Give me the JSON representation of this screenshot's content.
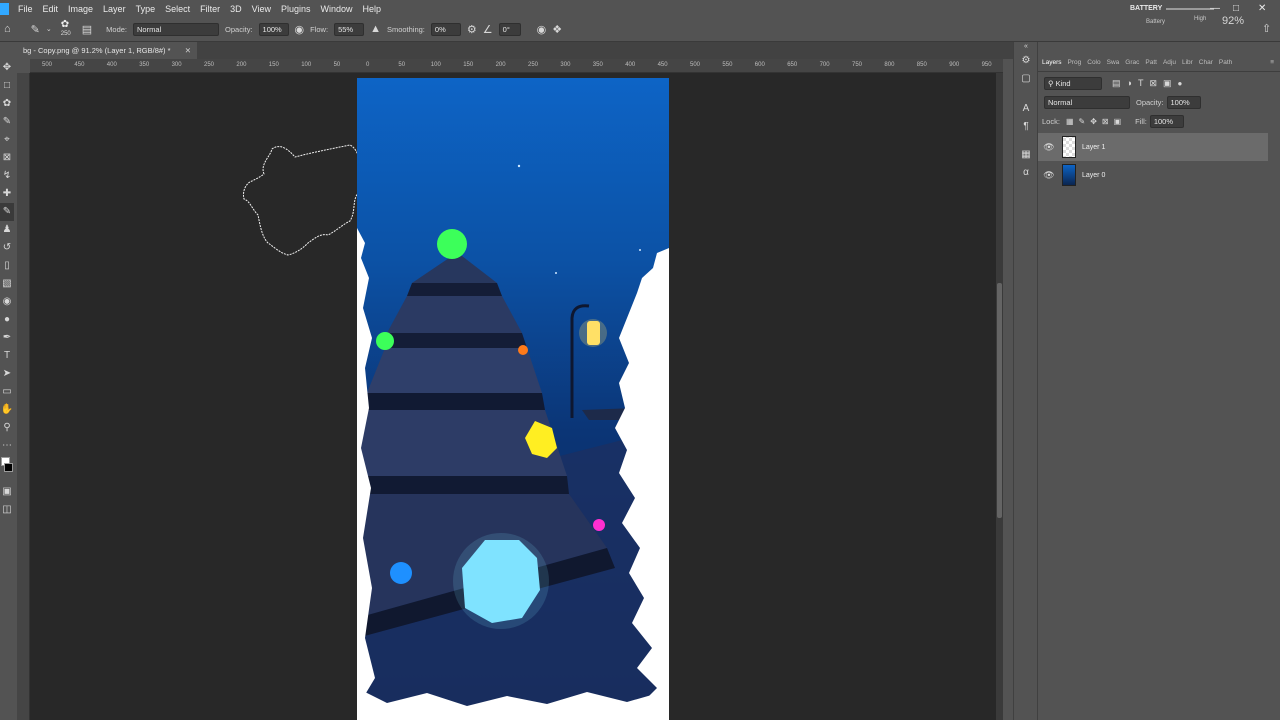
{
  "menu": {
    "items": [
      "File",
      "Edit",
      "Image",
      "Layer",
      "Type",
      "Select",
      "Filter",
      "3D",
      "View",
      "Plugins",
      "Window",
      "Help"
    ]
  },
  "system": {
    "battery_label": "BATTERY",
    "battery_sublabel": "Battery",
    "power_mode": "High",
    "battery_percent": "92%",
    "minimize_icon": "minimize-icon",
    "maximize_icon": "maximize-icon",
    "close_icon": "close-icon"
  },
  "options_bar": {
    "brush_size": "250",
    "mode_label": "Mode:",
    "mode_value": "Normal",
    "opacity_label": "Opacity:",
    "opacity_value": "100%",
    "flow_label": "Flow:",
    "flow_value": "55%",
    "smoothing_label": "Smoothing:",
    "smoothing_value": "0%",
    "angle_value": "0°"
  },
  "document": {
    "tab_title": "bg - Copy.png @ 91.2% (Layer 1, RGB/8#) *"
  },
  "ruler_ticks": [
    "500",
    "450",
    "400",
    "350",
    "300",
    "250",
    "200",
    "150",
    "100",
    "50",
    "0",
    "50",
    "100",
    "150",
    "200",
    "250",
    "300",
    "350",
    "400",
    "450",
    "500",
    "550",
    "600",
    "650",
    "700",
    "750",
    "800",
    "850",
    "900",
    "950",
    "1000"
  ],
  "layers_panel": {
    "tabs": [
      "Layers",
      "Prog",
      "Colo",
      "Swa",
      "Grac",
      "Patt",
      "Adju",
      "Libr",
      "Char",
      "Path"
    ],
    "active_tab": "Layers",
    "filter_kind": "Kind",
    "blend_mode": "Normal",
    "opacity_label": "Opacity:",
    "opacity_value": "100%",
    "lock_label": "Lock:",
    "fill_label": "Fill:",
    "fill_value": "100%",
    "layers": [
      {
        "name": "Layer 1",
        "selected": true
      },
      {
        "name": "Layer 0",
        "selected": false
      }
    ]
  },
  "colors": {
    "ui_panel": "#535353",
    "canvas_bg": "#282828",
    "sky_top": "#0d64c6",
    "sky_bottom": "#0b254f",
    "accent": "#31a8ff"
  }
}
